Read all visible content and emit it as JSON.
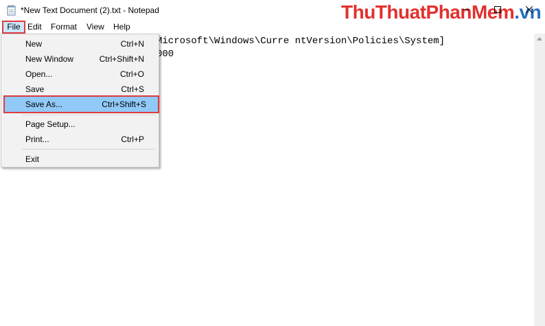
{
  "window": {
    "title": "*New Text Document (2).txt - Notepad",
    "minimize_symbol": "—",
    "watermark_part1": "ThuThuat",
    "watermark_part2": "PhanMem",
    "watermark_part3": ".vn"
  },
  "menubar": {
    "items": [
      "File",
      "Edit",
      "Format",
      "View",
      "Help"
    ]
  },
  "editor": {
    "lines": [
      "Microsoft\\Windows\\Curre ntVersion\\Policies\\System]",
      "000"
    ]
  },
  "file_menu": {
    "items": [
      {
        "label": "New",
        "shortcut": "Ctrl+N"
      },
      {
        "label": "New Window",
        "shortcut": "Ctrl+Shift+N"
      },
      {
        "label": "Open...",
        "shortcut": "Ctrl+O"
      },
      {
        "label": "Save",
        "shortcut": "Ctrl+S"
      },
      {
        "label": "Save As...",
        "shortcut": "Ctrl+Shift+S"
      },
      {
        "label": "Page Setup...",
        "shortcut": ""
      },
      {
        "label": "Print...",
        "shortcut": "Ctrl+P"
      },
      {
        "label": "Exit",
        "shortcut": ""
      }
    ],
    "highlighted": "Save As..."
  },
  "colors": {
    "highlight": "#91c9f7",
    "annotation_border": "#e03a3e",
    "watermark_red": "#e2312f",
    "watermark_blue": "#2a6ebb"
  },
  "icons": [
    "notepad-icon",
    "minimize-icon",
    "maximize-icon",
    "close-icon",
    "scroll-up-arrow-icon"
  ]
}
